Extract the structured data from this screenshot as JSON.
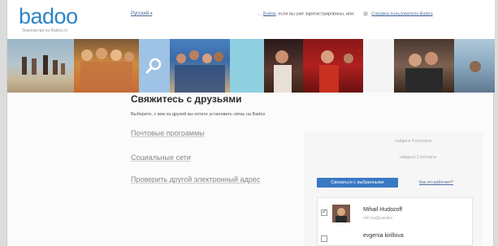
{
  "header": {
    "logo_text": "badoo",
    "logo_tagline": "Знакомства на Badoo.ru",
    "language": "Русский",
    "language_caret": "▾",
    "login_prefix": "Войти",
    "login_rest": ", если вы уже зарегистрированы, или",
    "help_link": "Справка пользователя Badoo"
  },
  "main": {
    "title": "Свяжитесь с друзьями",
    "subtitle": "Выберите, с кем из друзей вы хотите установить связь на Badoo",
    "options": [
      "Почтовые программы",
      "Социальные сети",
      "Проверить другой электронный адрес"
    ]
  },
  "panel": {
    "hint_top": "найдено 4 контакта",
    "hint_second": "найдено 2 контакта",
    "connect_button": "Связаться с выбранными",
    "how_link": "Как это работает?",
    "contacts": [
      {
        "name": "Mihail Hudozoff",
        "email": "mih.ha@yandex",
        "checked": "✓"
      },
      {
        "name": "evgenia kirillova",
        "email": "",
        "checked": ""
      }
    ]
  },
  "icons": {
    "search": "search-icon",
    "bulb": "lightbulb-icon"
  },
  "colors": {
    "brand_blue": "#2c84c9",
    "button_blue": "#3a78c3",
    "link_blue": "#4a6c9b",
    "search_tile": "#9fc3e4"
  }
}
